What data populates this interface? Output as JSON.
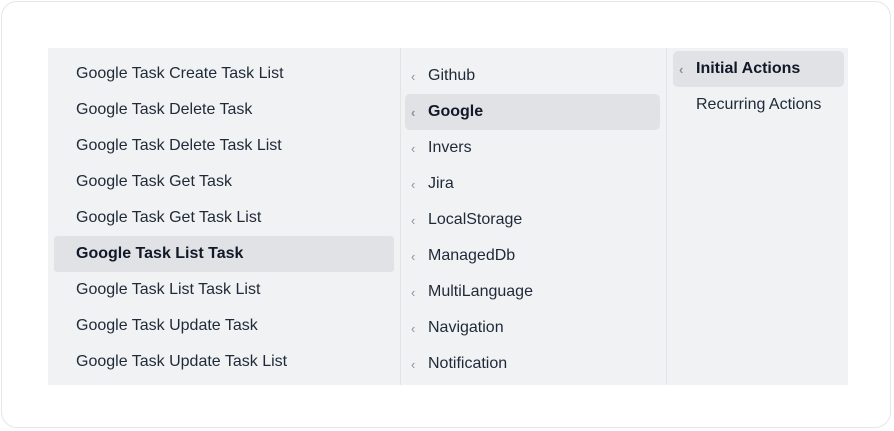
{
  "menu": {
    "left_column": {
      "items": [
        {
          "label": "Google Task Create Task List"
        },
        {
          "label": "Google Task Delete Task"
        },
        {
          "label": "Google Task Delete Task List"
        },
        {
          "label": "Google Task Get Task"
        },
        {
          "label": "Google Task Get Task List"
        },
        {
          "label": "Google Task List Task"
        },
        {
          "label": "Google Task List Task List"
        },
        {
          "label": "Google Task Update Task"
        },
        {
          "label": "Google Task Update Task List"
        }
      ],
      "selected": "Google Task List Task"
    },
    "middle_column": {
      "chevron_icon": "chevron-left-icon",
      "items": [
        {
          "label": "Github"
        },
        {
          "label": "Google"
        },
        {
          "label": "Invers"
        },
        {
          "label": "Jira"
        },
        {
          "label": "LocalStorage"
        },
        {
          "label": "ManagedDb"
        },
        {
          "label": "MultiLanguage"
        },
        {
          "label": "Navigation"
        },
        {
          "label": "Notification"
        }
      ],
      "selected": "Google"
    },
    "right_column": {
      "chevron_icon": "chevron-left-icon",
      "items": [
        {
          "label": "Initial Actions"
        },
        {
          "label": "Recurring Actions"
        }
      ],
      "selected": "Initial Actions"
    }
  },
  "colors": {
    "menu_background": "#f1f2f4",
    "selected_background": "#e0e2e6",
    "text": "#1f2937",
    "chevron": "#8a9099"
  }
}
